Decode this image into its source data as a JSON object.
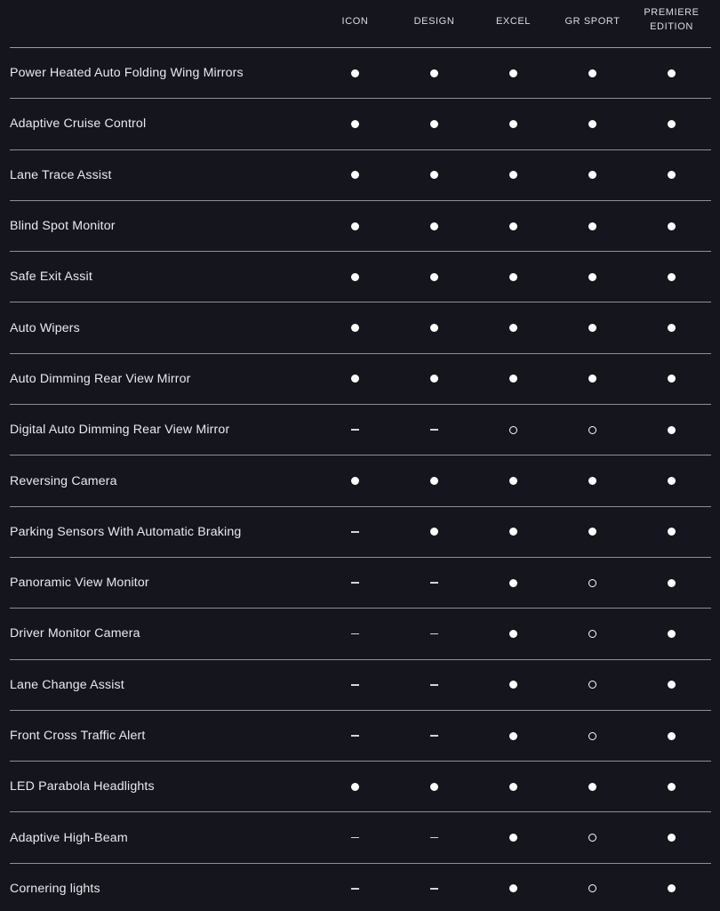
{
  "table": {
    "feature_column_header": "",
    "grades": [
      {
        "label": "ICON",
        "lines": [
          "ICON"
        ]
      },
      {
        "label": "DESIGN",
        "lines": [
          "DESIGN"
        ]
      },
      {
        "label": "EXCEL",
        "lines": [
          "EXCEL"
        ]
      },
      {
        "label": "GR SPORT",
        "lines": [
          "GR SPORT"
        ]
      },
      {
        "label": "PREMIERE EDITION",
        "lines": [
          "PREMIERE",
          "EDITION"
        ]
      }
    ],
    "legend": {
      "standard": "dot",
      "optional": "ring",
      "unavailable": "dash"
    },
    "rows": [
      {
        "feature": "Power Heated Auto Folding Wing Mirrors",
        "marks": [
          "dot",
          "dot",
          "dot",
          "dot",
          "dot"
        ]
      },
      {
        "feature": "Adaptive Cruise Control",
        "marks": [
          "dot",
          "dot",
          "dot",
          "dot",
          "dot"
        ]
      },
      {
        "feature": "Lane Trace Assist",
        "marks": [
          "dot",
          "dot",
          "dot",
          "dot",
          "dot"
        ]
      },
      {
        "feature": "Blind Spot Monitor",
        "marks": [
          "dot",
          "dot",
          "dot",
          "dot",
          "dot"
        ]
      },
      {
        "feature": "Safe Exit Assit",
        "marks": [
          "dot",
          "dot",
          "dot",
          "dot",
          "dot"
        ]
      },
      {
        "feature": "Auto Wipers",
        "marks": [
          "dot",
          "dot",
          "dot",
          "dot",
          "dot"
        ]
      },
      {
        "feature": "Auto Dimming Rear View Mirror",
        "marks": [
          "dot",
          "dot",
          "dot",
          "dot",
          "dot"
        ]
      },
      {
        "feature": "Digital Auto Dimming Rear View Mirror",
        "marks": [
          "dash",
          "dash",
          "ring",
          "ring",
          "dot"
        ]
      },
      {
        "feature": "Reversing Camera",
        "marks": [
          "dot",
          "dot",
          "dot",
          "dot",
          "dot"
        ]
      },
      {
        "feature": "Parking Sensors With Automatic Braking",
        "marks": [
          "dash",
          "dot",
          "dot",
          "dot",
          "dot"
        ]
      },
      {
        "feature": "Panoramic View Monitor",
        "marks": [
          "dash",
          "dash",
          "dot",
          "ring",
          "dot"
        ]
      },
      {
        "feature": "Driver Monitor Camera",
        "marks": [
          "dash",
          "dash",
          "dot",
          "ring",
          "dot"
        ]
      },
      {
        "feature": "Lane Change Assist",
        "marks": [
          "dash",
          "dash",
          "dot",
          "ring",
          "dot"
        ]
      },
      {
        "feature": "Front Cross Traffic Alert",
        "marks": [
          "dash",
          "dash",
          "dot",
          "ring",
          "dot"
        ]
      },
      {
        "feature": "LED Parabola Headlights",
        "marks": [
          "dot",
          "dot",
          "dot",
          "dot",
          "dot"
        ]
      },
      {
        "feature": "Adaptive High-Beam",
        "marks": [
          "dash",
          "dash",
          "dot",
          "ring",
          "dot"
        ]
      },
      {
        "feature": "Cornering lights",
        "marks": [
          "dash",
          "dash",
          "dot",
          "ring",
          "dot"
        ]
      }
    ]
  },
  "colors": {
    "background": "#15161d",
    "text": "#e9eaee",
    "header_text": "#dcdde1",
    "divider": "#8d8f99",
    "marker": "#ffffff"
  }
}
